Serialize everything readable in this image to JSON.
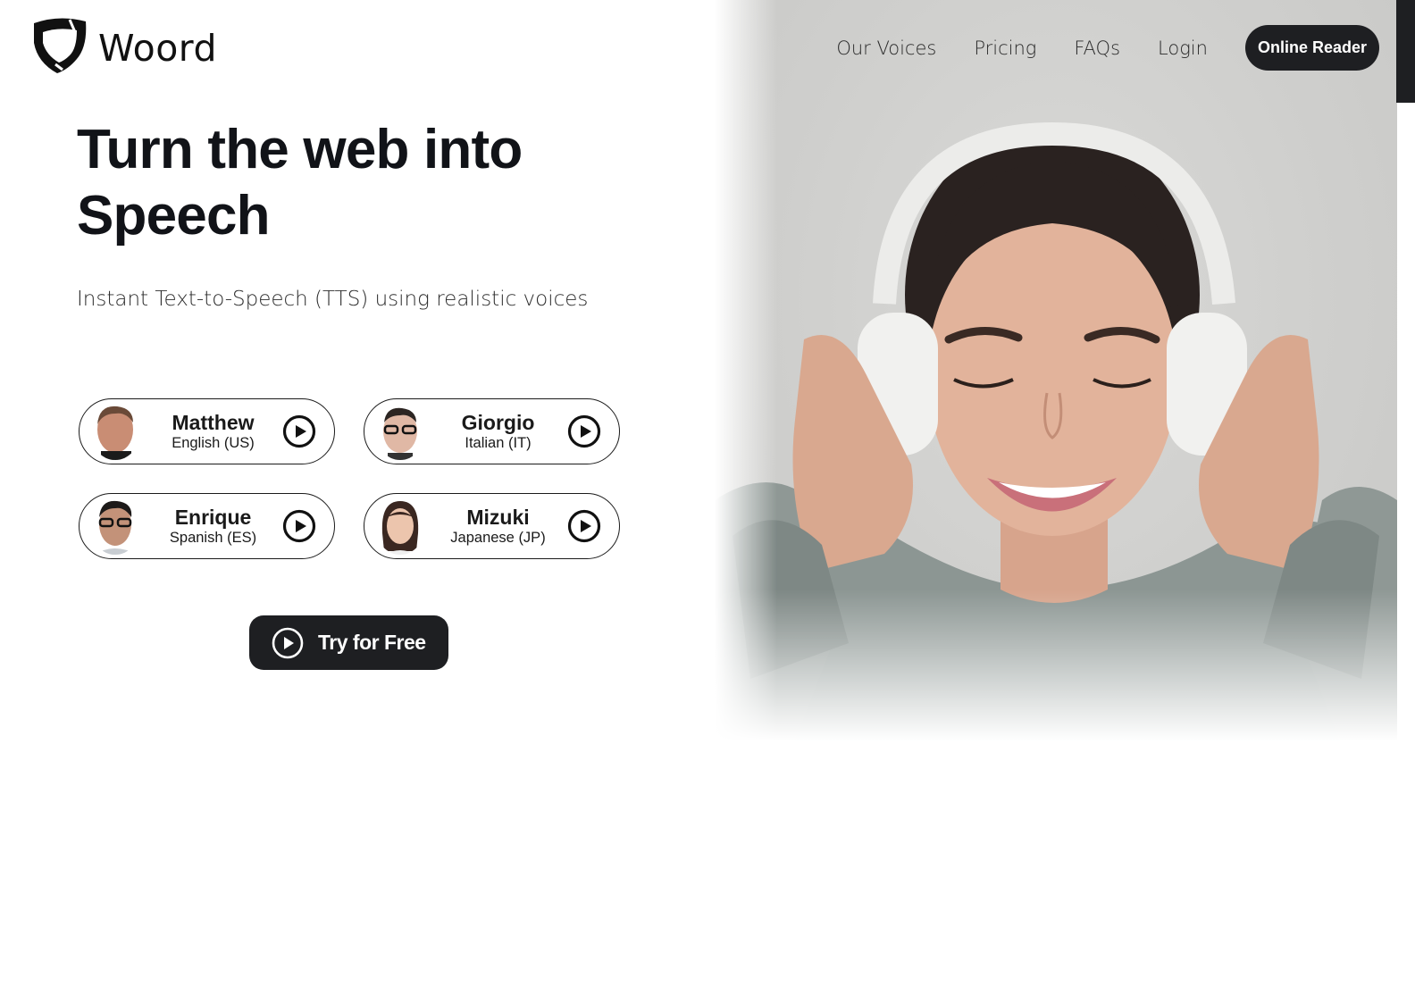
{
  "brand": {
    "name": "Woord",
    "logo_icon": "shield-icon"
  },
  "nav": {
    "links": [
      "Our Voices",
      "Pricing",
      "FAQs",
      "Login"
    ],
    "cta_label": "Online Reader"
  },
  "hero": {
    "headline_line1": "Turn the web into",
    "headline_line2": "Speech",
    "subheadline": "Instant Text-to-Speech (TTS) using realistic voices",
    "image_alt": "woman-with-headphones-photo"
  },
  "voices": [
    {
      "name": "Matthew",
      "language": "English (US)",
      "icon": "play-icon"
    },
    {
      "name": "Giorgio",
      "language": "Italian (IT)",
      "icon": "play-icon"
    },
    {
      "name": "Enrique",
      "language": "Spanish (ES)",
      "icon": "play-icon"
    },
    {
      "name": "Mizuki",
      "language": "Japanese (JP)",
      "icon": "play-icon"
    }
  ],
  "cta": {
    "label": "Try for Free",
    "icon": "play-icon"
  },
  "colors": {
    "dark": "#1e1f22",
    "text": "#111318",
    "background": "#ffffff"
  }
}
